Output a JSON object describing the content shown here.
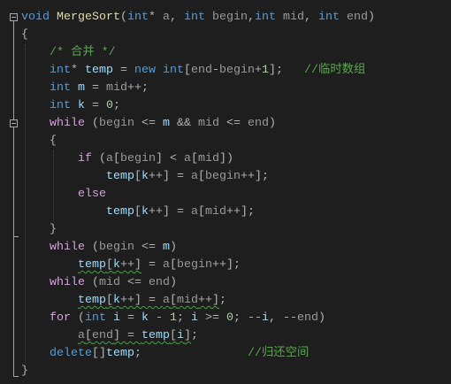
{
  "theme": {
    "background": "#1e1e1e",
    "outline": "#a5a5a5",
    "indent_guide": "#404040",
    "warning_squiggle": "#3fa045",
    "syntax": {
      "kw": "#569cd6",
      "ctl": "#d8a0df",
      "fn": "#dcdcaa",
      "param": "#9a9a9a",
      "local": "#9cdcfe",
      "num": "#b5cea8",
      "comment": "#57a64a",
      "punc": "#b4b4b4"
    }
  },
  "editor": {
    "lines": [
      [
        {
          "text": "void ",
          "kind": "kw"
        },
        {
          "text": "MergeSort",
          "kind": "fn"
        },
        {
          "text": "(",
          "kind": "punc"
        },
        {
          "text": "int",
          "kind": "kw"
        },
        {
          "text": "* ",
          "kind": "punc"
        },
        {
          "text": "a",
          "kind": "param"
        },
        {
          "text": ", ",
          "kind": "punc"
        },
        {
          "text": "int ",
          "kind": "kw"
        },
        {
          "text": "begin",
          "kind": "param"
        },
        {
          "text": ",",
          "kind": "punc"
        },
        {
          "text": "int ",
          "kind": "kw"
        },
        {
          "text": "mid",
          "kind": "param"
        },
        {
          "text": ", ",
          "kind": "punc"
        },
        {
          "text": "int ",
          "kind": "kw"
        },
        {
          "text": "end",
          "kind": "param"
        },
        {
          "text": ")",
          "kind": "punc"
        }
      ],
      [
        {
          "text": "{",
          "kind": "punc"
        }
      ],
      [
        {
          "text": "    ",
          "kind": "ws"
        },
        {
          "text": "/* 合并 */",
          "kind": "comment"
        }
      ],
      [
        {
          "text": "    ",
          "kind": "ws"
        },
        {
          "text": "int",
          "kind": "kw"
        },
        {
          "text": "* ",
          "kind": "punc"
        },
        {
          "text": "temp",
          "kind": "local"
        },
        {
          "text": " = ",
          "kind": "punc"
        },
        {
          "text": "new int",
          "kind": "kw"
        },
        {
          "text": "[",
          "kind": "punc"
        },
        {
          "text": "end",
          "kind": "param"
        },
        {
          "text": "-",
          "kind": "punc"
        },
        {
          "text": "begin",
          "kind": "param"
        },
        {
          "text": "+",
          "kind": "punc"
        },
        {
          "text": "1",
          "kind": "num"
        },
        {
          "text": "];   ",
          "kind": "punc"
        },
        {
          "text": "//临时数组",
          "kind": "comment"
        }
      ],
      [
        {
          "text": "    ",
          "kind": "ws"
        },
        {
          "text": "int ",
          "kind": "kw"
        },
        {
          "text": "m",
          "kind": "local"
        },
        {
          "text": " = ",
          "kind": "punc"
        },
        {
          "text": "mid",
          "kind": "param"
        },
        {
          "text": "++;",
          "kind": "punc"
        }
      ],
      [
        {
          "text": "    ",
          "kind": "ws"
        },
        {
          "text": "int ",
          "kind": "kw"
        },
        {
          "text": "k",
          "kind": "local"
        },
        {
          "text": " = ",
          "kind": "punc"
        },
        {
          "text": "0",
          "kind": "num"
        },
        {
          "text": ";",
          "kind": "punc"
        }
      ],
      [
        {
          "text": "    ",
          "kind": "ws"
        },
        {
          "text": "while ",
          "kind": "ctl"
        },
        {
          "text": "(",
          "kind": "punc"
        },
        {
          "text": "begin",
          "kind": "param"
        },
        {
          "text": " <= ",
          "kind": "punc"
        },
        {
          "text": "m",
          "kind": "local"
        },
        {
          "text": " && ",
          "kind": "punc"
        },
        {
          "text": "mid",
          "kind": "param"
        },
        {
          "text": " <= ",
          "kind": "punc"
        },
        {
          "text": "end",
          "kind": "param"
        },
        {
          "text": ")",
          "kind": "punc"
        }
      ],
      [
        {
          "text": "    ",
          "kind": "ws"
        },
        {
          "text": "{",
          "kind": "punc"
        }
      ],
      [
        {
          "text": "        ",
          "kind": "ws"
        },
        {
          "text": "if ",
          "kind": "ctl"
        },
        {
          "text": "(",
          "kind": "punc"
        },
        {
          "text": "a",
          "kind": "param"
        },
        {
          "text": "[",
          "kind": "punc"
        },
        {
          "text": "begin",
          "kind": "param"
        },
        {
          "text": "] < ",
          "kind": "punc"
        },
        {
          "text": "a",
          "kind": "param"
        },
        {
          "text": "[",
          "kind": "punc"
        },
        {
          "text": "mid",
          "kind": "param"
        },
        {
          "text": "])",
          "kind": "punc"
        }
      ],
      [
        {
          "text": "            ",
          "kind": "ws"
        },
        {
          "text": "temp",
          "kind": "local"
        },
        {
          "text": "[",
          "kind": "punc"
        },
        {
          "text": "k",
          "kind": "local"
        },
        {
          "text": "++] = ",
          "kind": "punc"
        },
        {
          "text": "a",
          "kind": "param"
        },
        {
          "text": "[",
          "kind": "punc"
        },
        {
          "text": "begin",
          "kind": "param"
        },
        {
          "text": "++];",
          "kind": "punc"
        }
      ],
      [
        {
          "text": "        ",
          "kind": "ws"
        },
        {
          "text": "else",
          "kind": "ctl"
        }
      ],
      [
        {
          "text": "            ",
          "kind": "ws"
        },
        {
          "text": "temp",
          "kind": "local"
        },
        {
          "text": "[",
          "kind": "punc"
        },
        {
          "text": "k",
          "kind": "local"
        },
        {
          "text": "++] = ",
          "kind": "punc"
        },
        {
          "text": "a",
          "kind": "param"
        },
        {
          "text": "[",
          "kind": "punc"
        },
        {
          "text": "mid",
          "kind": "param"
        },
        {
          "text": "++];",
          "kind": "punc"
        }
      ],
      [
        {
          "text": "    ",
          "kind": "ws"
        },
        {
          "text": "}",
          "kind": "punc"
        }
      ],
      [
        {
          "text": "    ",
          "kind": "ws"
        },
        {
          "text": "while ",
          "kind": "ctl"
        },
        {
          "text": "(",
          "kind": "punc"
        },
        {
          "text": "begin",
          "kind": "param"
        },
        {
          "text": " <= ",
          "kind": "punc"
        },
        {
          "text": "m",
          "kind": "local"
        },
        {
          "text": ")",
          "kind": "punc"
        }
      ],
      [
        {
          "text": "        ",
          "kind": "ws"
        },
        {
          "text": "temp",
          "kind": "local",
          "warn": true
        },
        {
          "text": "[",
          "kind": "punc",
          "warn": true
        },
        {
          "text": "k",
          "kind": "local",
          "warn": true
        },
        {
          "text": "++]",
          "kind": "punc",
          "warn": true
        },
        {
          "text": " = ",
          "kind": "punc"
        },
        {
          "text": "a",
          "kind": "param"
        },
        {
          "text": "[",
          "kind": "punc"
        },
        {
          "text": "begin",
          "kind": "param"
        },
        {
          "text": "++];",
          "kind": "punc"
        }
      ],
      [
        {
          "text": "    ",
          "kind": "ws"
        },
        {
          "text": "while ",
          "kind": "ctl"
        },
        {
          "text": "(",
          "kind": "punc"
        },
        {
          "text": "mid",
          "kind": "param"
        },
        {
          "text": " <= ",
          "kind": "punc"
        },
        {
          "text": "end",
          "kind": "param"
        },
        {
          "text": ")",
          "kind": "punc"
        }
      ],
      [
        {
          "text": "        ",
          "kind": "ws"
        },
        {
          "text": "temp",
          "kind": "local",
          "warn": true
        },
        {
          "text": "[",
          "kind": "punc",
          "warn": true
        },
        {
          "text": "k",
          "kind": "local",
          "warn": true
        },
        {
          "text": "++] = ",
          "kind": "punc",
          "warn": true
        },
        {
          "text": "a",
          "kind": "param",
          "warn": true
        },
        {
          "text": "[",
          "kind": "punc",
          "warn": true
        },
        {
          "text": "mid",
          "kind": "param",
          "warn": true
        },
        {
          "text": "++]",
          "kind": "punc",
          "warn": true
        },
        {
          "text": ";",
          "kind": "punc"
        }
      ],
      [
        {
          "text": "    ",
          "kind": "ws"
        },
        {
          "text": "for ",
          "kind": "ctl"
        },
        {
          "text": "(",
          "kind": "punc"
        },
        {
          "text": "int ",
          "kind": "kw"
        },
        {
          "text": "i",
          "kind": "local"
        },
        {
          "text": " = ",
          "kind": "punc"
        },
        {
          "text": "k",
          "kind": "local"
        },
        {
          "text": " - ",
          "kind": "punc"
        },
        {
          "text": "1",
          "kind": "num"
        },
        {
          "text": "; ",
          "kind": "punc"
        },
        {
          "text": "i",
          "kind": "local"
        },
        {
          "text": " >= ",
          "kind": "punc"
        },
        {
          "text": "0",
          "kind": "num"
        },
        {
          "text": "; --",
          "kind": "punc"
        },
        {
          "text": "i",
          "kind": "local"
        },
        {
          "text": ", --",
          "kind": "punc"
        },
        {
          "text": "end",
          "kind": "param"
        },
        {
          "text": ")",
          "kind": "punc"
        }
      ],
      [
        {
          "text": "        ",
          "kind": "ws"
        },
        {
          "text": "a",
          "kind": "param",
          "warn": true
        },
        {
          "text": "[",
          "kind": "punc",
          "warn": true
        },
        {
          "text": "end",
          "kind": "param",
          "warn": true
        },
        {
          "text": "] = ",
          "kind": "punc",
          "warn": true
        },
        {
          "text": "temp",
          "kind": "local",
          "warn": true
        },
        {
          "text": "[",
          "kind": "punc",
          "warn": true
        },
        {
          "text": "i",
          "kind": "local",
          "warn": true
        },
        {
          "text": "]",
          "kind": "punc",
          "warn": true
        },
        {
          "text": ";",
          "kind": "punc"
        }
      ],
      [
        {
          "text": "    ",
          "kind": "ws"
        },
        {
          "text": "delete",
          "kind": "kw"
        },
        {
          "text": "[]",
          "kind": "punc"
        },
        {
          "text": "temp",
          "kind": "local"
        },
        {
          "text": ";               ",
          "kind": "punc"
        },
        {
          "text": "//归还空间",
          "kind": "comment"
        }
      ],
      [
        {
          "text": "}",
          "kind": "punc"
        }
      ]
    ]
  }
}
